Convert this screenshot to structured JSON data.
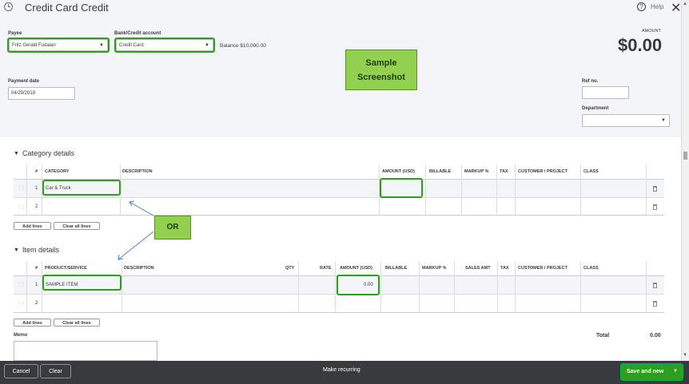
{
  "header": {
    "title": "Credit Card Credit",
    "help": "Help"
  },
  "payee": {
    "label": "Payee",
    "value": "Fritz Gerald Fudalan"
  },
  "account": {
    "label": "Bank/Credit account",
    "value": "Credit Card",
    "balance": "Balance $10,000.00"
  },
  "amount": {
    "label": "AMOUNT",
    "value": "$0.00"
  },
  "payment_date": {
    "label": "Payment date",
    "value": "04/29/2019"
  },
  "ref": {
    "label": "Ref no.",
    "value": ""
  },
  "department": {
    "label": "Department",
    "value": ""
  },
  "sample": {
    "line1": "Sample",
    "line2": "Screenshot"
  },
  "or_label": "OR",
  "category": {
    "section_title": "Category details",
    "headers": [
      "#",
      "CATEGORY",
      "DESCRIPTION",
      "AMOUNT (USD)",
      "BILLABLE",
      "MARKUP %",
      "TAX",
      "CUSTOMER / PROJECT",
      "CLASS"
    ],
    "rows": [
      {
        "num": "1",
        "category": "Car & Truck",
        "description": "",
        "amount": ""
      },
      {
        "num": "2",
        "category": "",
        "description": "",
        "amount": ""
      }
    ],
    "add_lines": "Add lines",
    "clear_lines": "Clear all lines"
  },
  "items": {
    "section_title": "Item details",
    "headers": [
      "#",
      "PRODUCT/SERVICE",
      "DESCRIPTION",
      "QTY",
      "RATE",
      "AMOUNT (USD)",
      "BILLABLE",
      "MARKUP %",
      "SALES AMT",
      "TAX",
      "CUSTOMER / PROJECT",
      "CLASS"
    ],
    "rows": [
      {
        "num": "1",
        "product": "SAMPLE ITEM",
        "amount": "0.00"
      },
      {
        "num": "2",
        "product": "",
        "amount": ""
      }
    ],
    "add_lines": "Add lines",
    "clear_lines": "Clear all lines"
  },
  "memo": {
    "label": "Memo"
  },
  "total": {
    "label": "Total",
    "value": "0.00"
  },
  "footer": {
    "cancel": "Cancel",
    "clear": "Clear",
    "recurring": "Make recurring",
    "save": "Save and new"
  }
}
